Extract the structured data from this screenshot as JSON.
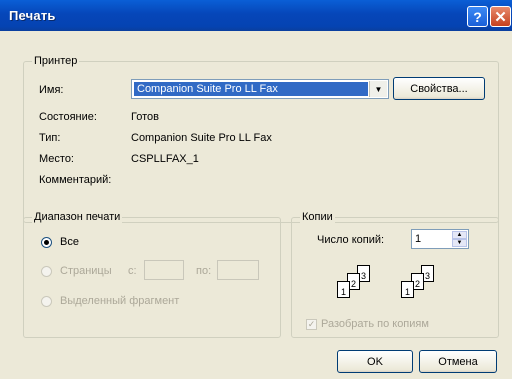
{
  "window": {
    "title": "Печать"
  },
  "printer": {
    "group_label": "Принтер",
    "name_label": "Имя:",
    "name_value": "Companion Suite Pro LL Fax",
    "properties_button": "Свойства...",
    "status_label": "Состояние:",
    "status_value": "Готов",
    "type_label": "Тип:",
    "type_value": "Companion Suite Pro LL Fax",
    "where_label": "Место:",
    "where_value": "CSPLLFAX_1",
    "comment_label": "Комментарий:"
  },
  "range": {
    "group_label": "Диапазон печати",
    "all": "Все",
    "pages": "Страницы",
    "from": "с:",
    "to": "по:",
    "selection": "Выделенный фрагмент"
  },
  "copies": {
    "group_label": "Копии",
    "count_label": "Число копий:",
    "count_value": "1",
    "collate": "Разобрать по копиям",
    "page_numbers": [
      "1",
      "2",
      "3"
    ]
  },
  "buttons": {
    "ok": "OK",
    "cancel": "Отмена"
  }
}
